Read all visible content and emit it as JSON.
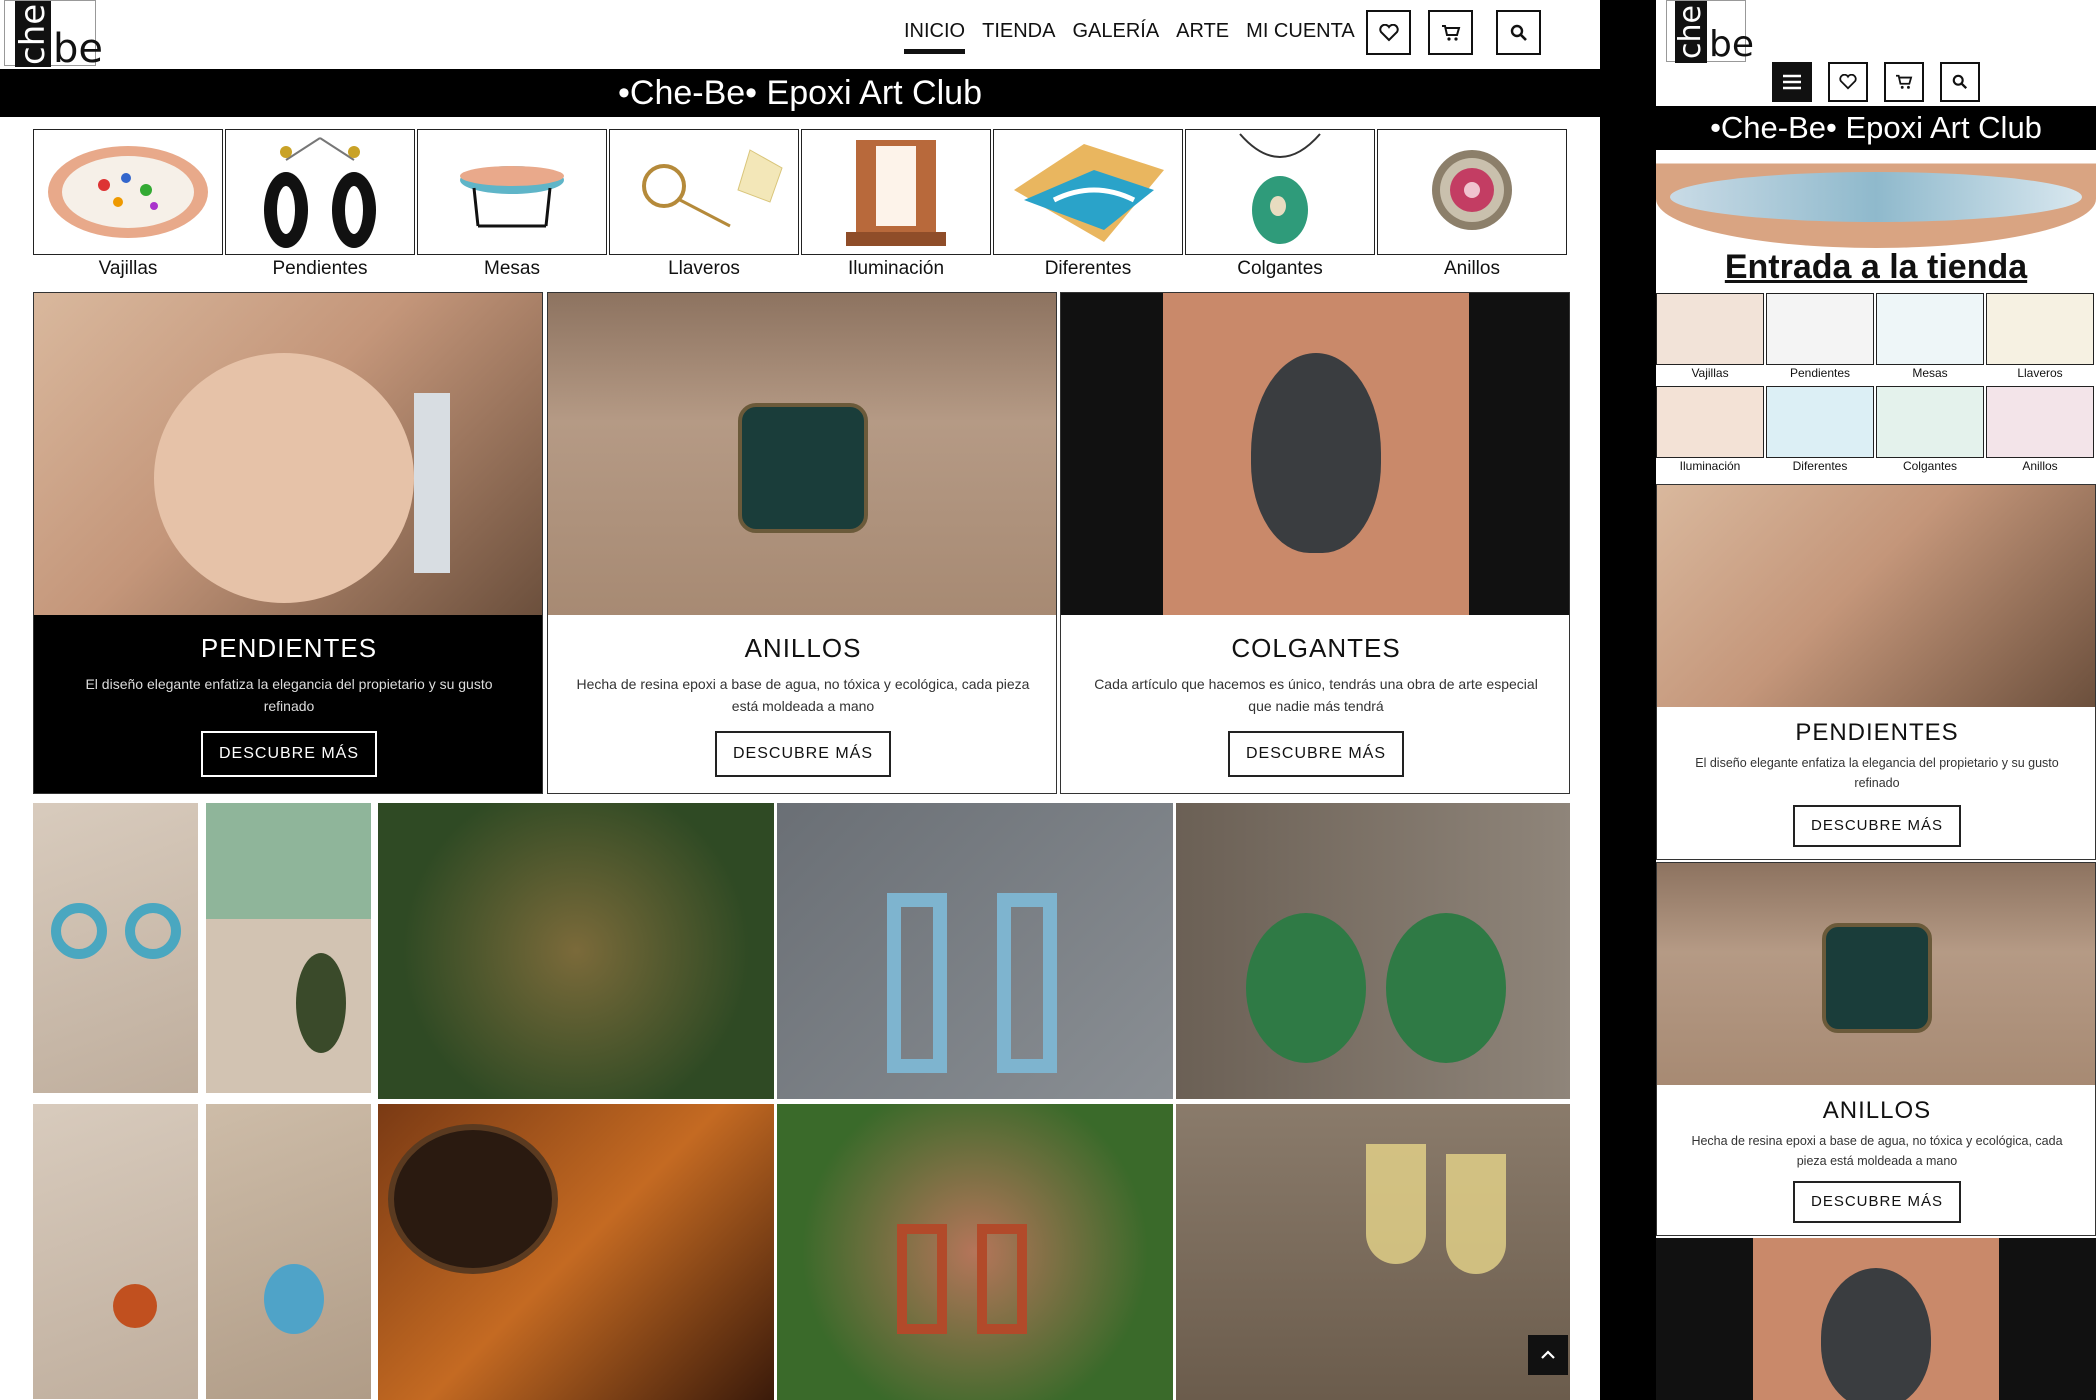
{
  "brand": {
    "logo_text_a": "che",
    "logo_text_b": "be",
    "title": "•Che-Be• Epoxi Art Club"
  },
  "nav": {
    "items": [
      "INICIO",
      "TIENDA",
      "GALERÍA",
      "ARTE",
      "MI CUENTA"
    ],
    "active": "INICIO"
  },
  "icons": {
    "wishlist": "heart-icon",
    "cart": "cart-icon",
    "search": "search-icon",
    "menu": "hamburger-icon",
    "scroll_top": "chevron-up-icon"
  },
  "categories": [
    "Vajillas",
    "Pendientes",
    "Mesas",
    "Llaveros",
    "Iluminación",
    "Diferentes",
    "Colgantes",
    "Anillos"
  ],
  "cards": [
    {
      "title": "PENDIENTES",
      "text": "El diseño elegante enfatiza la elegancia del propietario y su gusto refinado",
      "button": "DESCUBRE MÁS"
    },
    {
      "title": "ANILLOS",
      "text": "Hecha de resina epoxi a base de agua, no tóxica y ecológica, cada pieza está moldeada a mano",
      "button": "DESCUBRE MÁS"
    },
    {
      "title": "COLGANTES",
      "text": "Cada artículo que hacemos es único, tendrás una obra de arte especial que nadie más tendrá",
      "button": "DESCUBRE MÁS"
    }
  ],
  "mobile": {
    "shop_link": "Entrada a la tienda"
  },
  "colors": {
    "bg": "#000000",
    "surface": "#ffffff",
    "text": "#111111"
  }
}
